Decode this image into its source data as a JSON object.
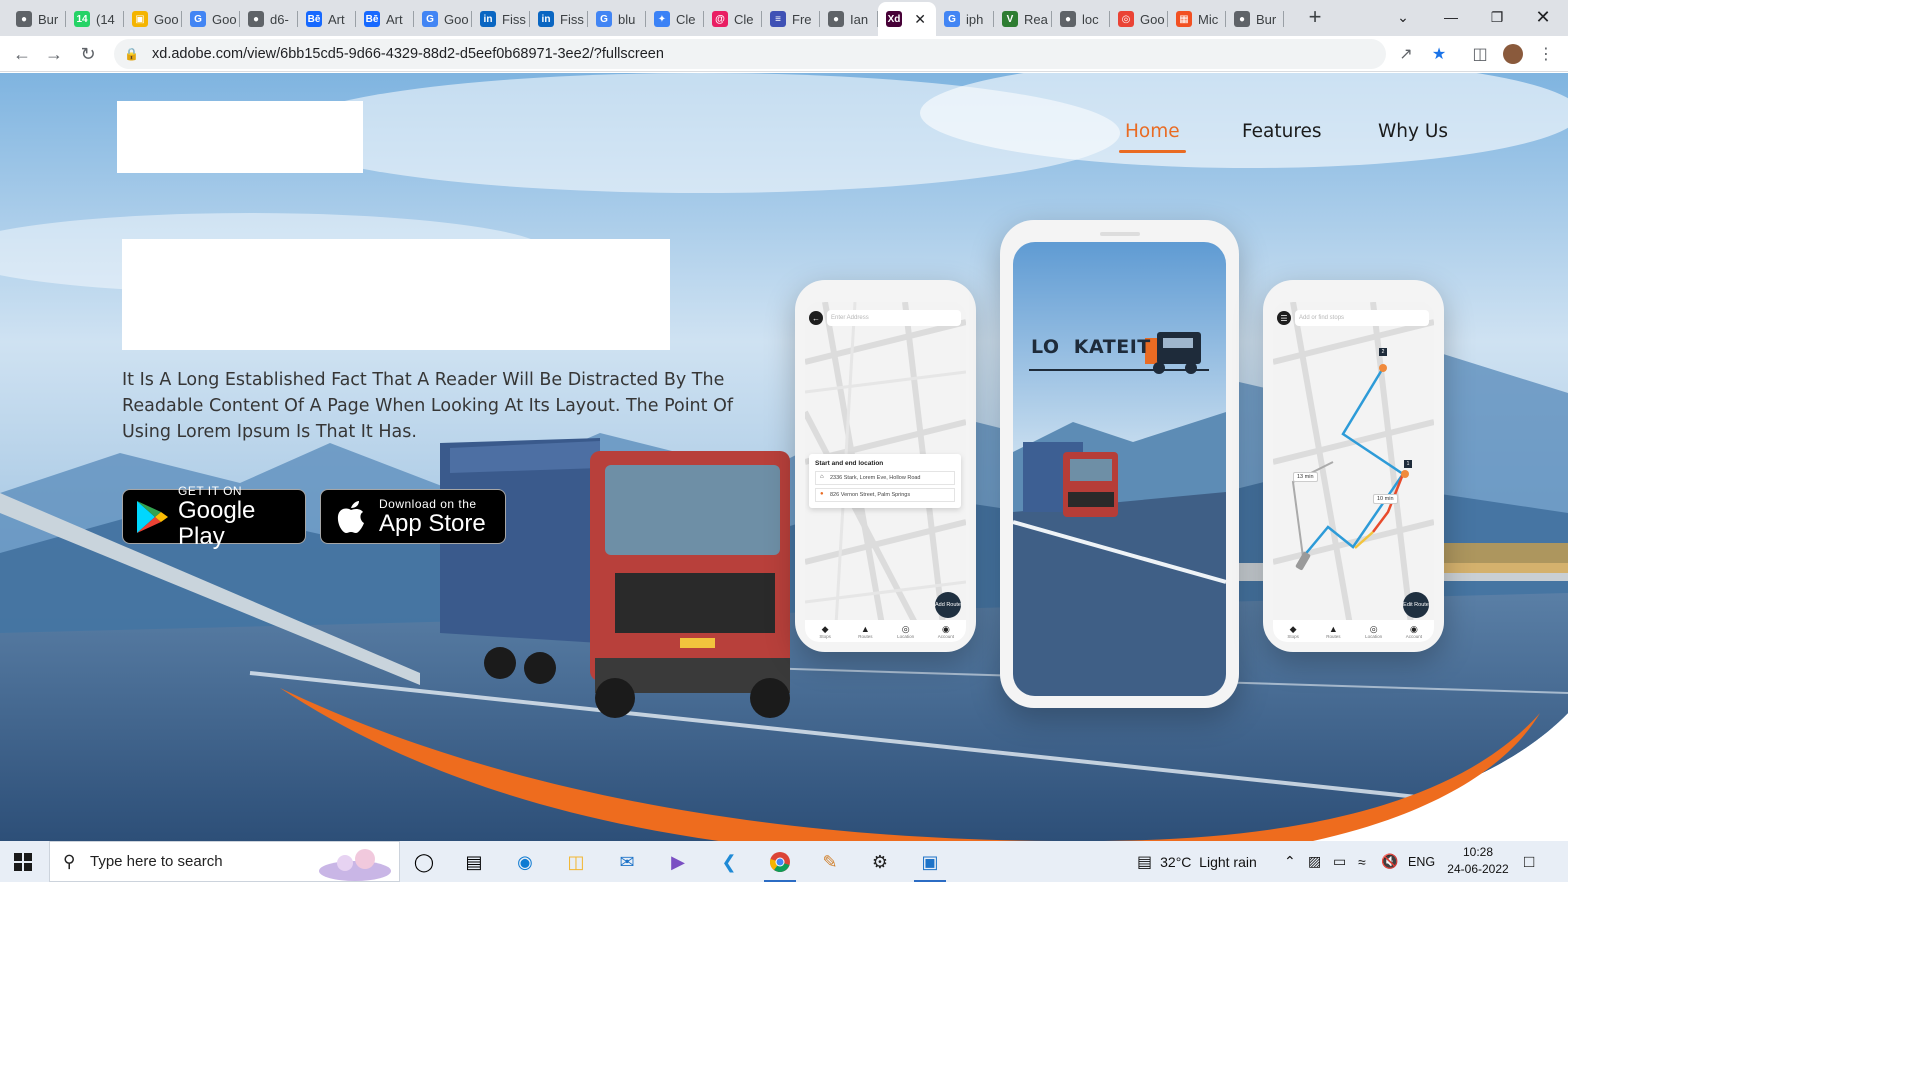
{
  "browser": {
    "tabs": [
      {
        "label": "Bur",
        "icon": "globe-icon",
        "color": "#5f6368"
      },
      {
        "label": "(14",
        "icon": "whatsapp-icon",
        "color": "#25d366"
      },
      {
        "label": "Goo",
        "icon": "google-slides-icon",
        "color": "#f4b400"
      },
      {
        "label": "Goo",
        "icon": "google-icon",
        "color": "#4285f4"
      },
      {
        "label": "d6-",
        "icon": "globe-icon",
        "color": "#5f6368"
      },
      {
        "label": "Art",
        "icon": "behance-icon",
        "color": "#1769ff"
      },
      {
        "label": "Art",
        "icon": "behance-icon",
        "color": "#1769ff"
      },
      {
        "label": "Goo",
        "icon": "google-icon",
        "color": "#4285f4"
      },
      {
        "label": "Fiss",
        "icon": "linkedin-icon",
        "color": "#0a66c2"
      },
      {
        "label": "Fiss",
        "icon": "linkedin-icon",
        "color": "#0a66c2"
      },
      {
        "label": "blu",
        "icon": "google-icon",
        "color": "#4285f4"
      },
      {
        "label": "Cle",
        "icon": "cleanup-icon",
        "color": "#3b82f6"
      },
      {
        "label": "Cle",
        "icon": "spiral-icon",
        "color": "#e91e63"
      },
      {
        "label": "Fre",
        "icon": "document-icon",
        "color": "#3f51b5"
      },
      {
        "label": "Ian",
        "icon": "globe-icon",
        "color": "#5f6368"
      },
      {
        "label": "",
        "icon": "adobe-xd-icon",
        "color": "#470137",
        "active": true
      },
      {
        "label": "iph",
        "icon": "google-icon",
        "color": "#4285f4"
      },
      {
        "label": "Rea",
        "icon": "vectorizer-icon",
        "color": "#2e7d32"
      },
      {
        "label": "loc",
        "icon": "globe-icon",
        "color": "#5f6368"
      },
      {
        "label": "Goo",
        "icon": "google-lens-icon",
        "color": "#ea4335"
      },
      {
        "label": "Mic",
        "icon": "microsoft-icon",
        "color": "#f25022"
      },
      {
        "label": "Bur",
        "icon": "globe-icon",
        "color": "#5f6368"
      }
    ],
    "url": "xd.adobe.com/view/6bb15cd5-9d66-4329-88d2-d5eef0b68971-3ee2/?fullscreen"
  },
  "site": {
    "nav": {
      "home": "Home",
      "features": "Features",
      "why_us": "Why Us"
    },
    "description": "It Is A Long Established Fact That A Reader Will Be Distracted By The Readable Content Of A Page When Looking At Its Layout. The Point Of Using Lorem Ipsum Is That It Has.",
    "google_play": {
      "small": "GET IT ON",
      "big": "Google Play"
    },
    "app_store": {
      "small": "Download on the",
      "big": "App Store"
    },
    "accent_color": "#e96b23"
  },
  "phones": {
    "left": {
      "search_placeholder": "Enter Address",
      "card_title": "Start and end location",
      "start_address": "2336 Stark, Lorem Eve, Hollow Road",
      "end_address": "826 Vernon Street, Palm Springs",
      "fab_label": "Add Route"
    },
    "center": {
      "logo_text": "LO  KATEIT"
    },
    "right": {
      "search_placeholder": "Add or find stops",
      "time_a": "13 min",
      "time_b": "10 min",
      "stop_1": "1",
      "stop_2": "2",
      "fab_label": "Edit Route"
    },
    "tabbar": [
      "Stops",
      "Routes",
      "Location",
      "Account"
    ]
  },
  "taskbar": {
    "search_placeholder": "Type here to search",
    "weather": "32°C  Light rain",
    "language": "ENG",
    "time": "10:28",
    "date": "24-06-2022"
  }
}
